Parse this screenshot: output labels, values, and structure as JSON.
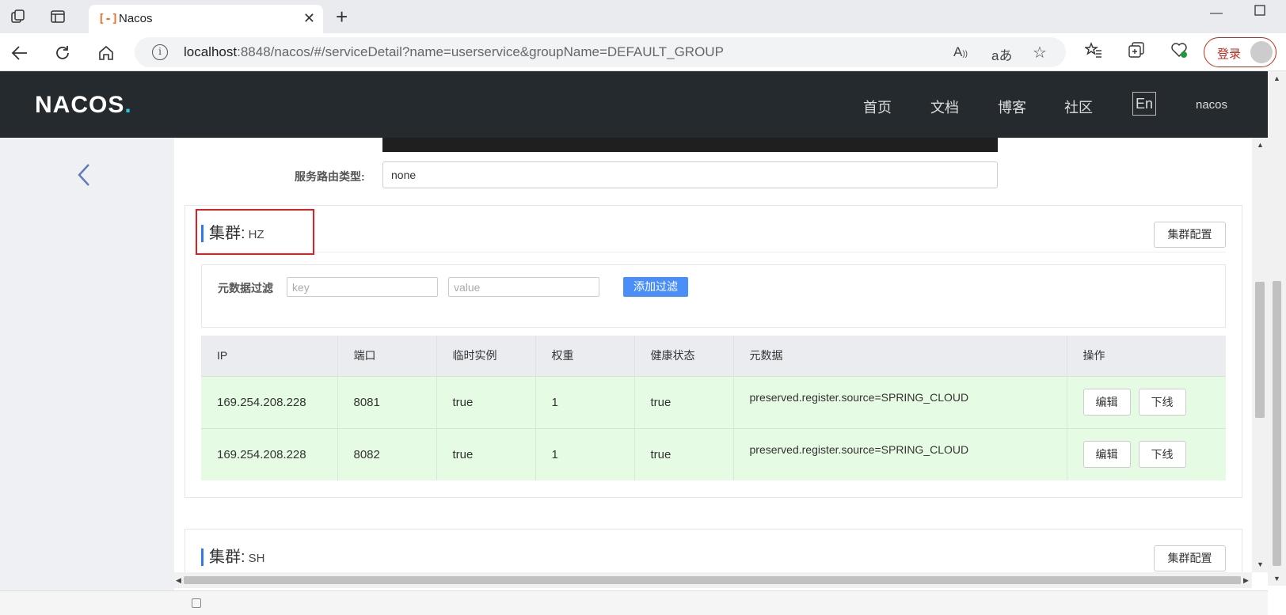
{
  "browser": {
    "tab_title": "Nacos",
    "url_host": "localhost",
    "url_rest": ":8848/nacos/#/serviceDetail?name=userservice&groupName=DEFAULT_GROUP",
    "login_label": "登录"
  },
  "app": {
    "logo_main": "NACOS",
    "logo_dot": ".",
    "nav": [
      "首页",
      "文档",
      "博客",
      "社区"
    ],
    "lang": "En",
    "user": "nacos"
  },
  "service": {
    "route_type_label": "服务路由类型:",
    "route_type_value": "none"
  },
  "clusters": [
    {
      "title_label": "集群:",
      "name": "HZ",
      "config_button": "集群配置",
      "filter": {
        "label": "元数据过滤",
        "key_placeholder": "key",
        "value_placeholder": "value",
        "add_button": "添加过滤"
      },
      "columns": [
        "IP",
        "端口",
        "临时实例",
        "权重",
        "健康状态",
        "元数据",
        "操作"
      ],
      "rows": [
        {
          "ip": "169.254.208.228",
          "port": "8081",
          "ephemeral": "true",
          "weight": "1",
          "healthy": "true",
          "metadata": "preserved.register.source=SPRING_CLOUD",
          "edit": "编辑",
          "offline": "下线"
        },
        {
          "ip": "169.254.208.228",
          "port": "8082",
          "ephemeral": "true",
          "weight": "1",
          "healthy": "true",
          "metadata": "preserved.register.source=SPRING_CLOUD",
          "edit": "编辑",
          "offline": "下线"
        }
      ]
    },
    {
      "title_label": "集群:",
      "name": "SH",
      "config_button": "集群配置"
    }
  ],
  "colors": {
    "header_bg": "#252a2f",
    "accent_blue": "#2f79e8",
    "healthy_row": "#e6fbe3",
    "highlight_red": "#e02020"
  }
}
